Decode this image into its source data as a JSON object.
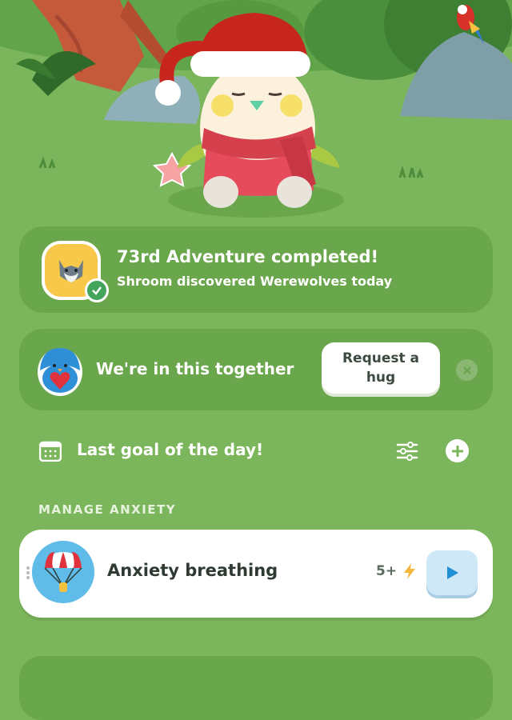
{
  "adventure": {
    "title": "73rd Adventure completed!",
    "subtitle": "Shroom discovered Werewolves today",
    "badge_icon": "werewolf-icon"
  },
  "hug": {
    "title": "We're in this together",
    "button_label": "Request a hug",
    "close_icon": "close-icon"
  },
  "goal": {
    "title": "Last goal of the day!",
    "icons": [
      "calendar-icon",
      "filter-icon",
      "add-icon"
    ]
  },
  "section": {
    "label": "MANAGE ANXIETY"
  },
  "activity": {
    "title": "Anxiety breathing",
    "points": "5+",
    "icon": "parachute-icon"
  },
  "colors": {
    "background": "#7cb65c",
    "card": "#6aa64b",
    "badge": "#f8c84a",
    "check": "#43a55c",
    "play": "#cfe8f7",
    "play_arrow": "#1f8fd6"
  }
}
